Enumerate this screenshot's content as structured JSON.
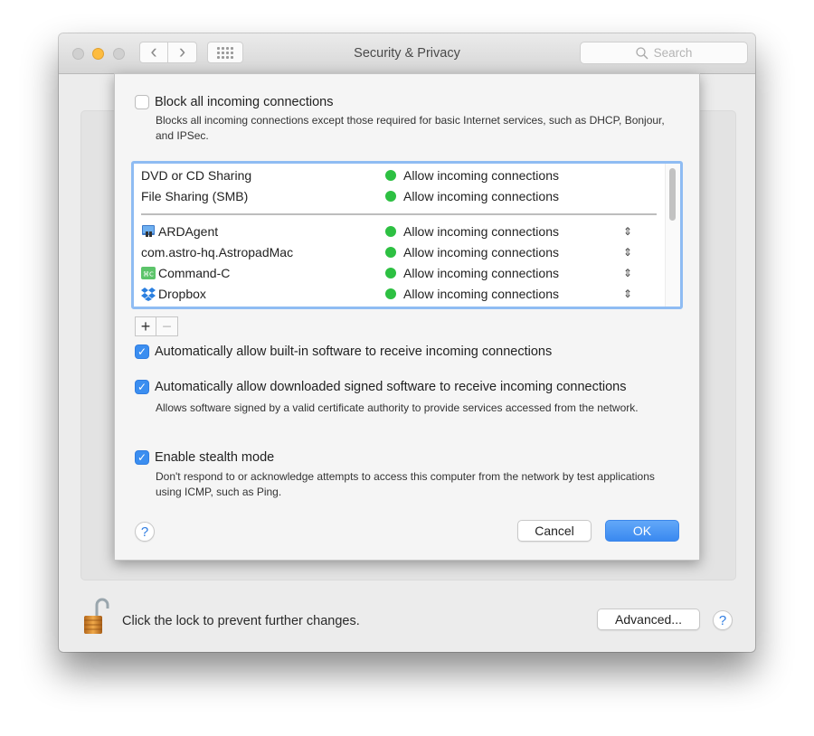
{
  "window": {
    "title": "Security & Privacy",
    "search_placeholder": "Search",
    "nav": {
      "back_icon": "‹",
      "forward_icon": "›"
    }
  },
  "sheet": {
    "block_all": {
      "label": "Block all incoming connections",
      "checked": false,
      "description": "Blocks all incoming connections except those required for basic Internet services,  such as DHCP, Bonjour, and IPSec."
    },
    "services": [
      {
        "name": "DVD or CD Sharing",
        "status": "Allow incoming connections"
      },
      {
        "name": "File Sharing (SMB)",
        "status": "Allow incoming connections"
      }
    ],
    "apps": [
      {
        "name": "ARDAgent",
        "icon": "ardagent-icon",
        "status": "Allow incoming connections"
      },
      {
        "name": "com.astro-hq.AstropadMac",
        "icon": "",
        "status": "Allow incoming connections"
      },
      {
        "name": "Command-C",
        "icon": "command-c-icon",
        "status": "Allow incoming connections"
      },
      {
        "name": "Dropbox",
        "icon": "dropbox-icon",
        "status": "Allow incoming connections"
      }
    ],
    "add_label": "+",
    "remove_label": "−",
    "auto_builtin": {
      "label": "Automatically allow built-in software to receive incoming connections",
      "checked": true
    },
    "auto_signed": {
      "label": "Automatically allow downloaded signed software to receive incoming connections",
      "checked": true,
      "description": "Allows software signed by a valid certificate authority to provide services accessed from the network."
    },
    "stealth": {
      "label": "Enable stealth mode",
      "checked": true,
      "description": "Don't respond to or acknowledge attempts to access this computer from the network by test applications using ICMP, such as Ping."
    },
    "help_label": "?",
    "cancel_label": "Cancel",
    "ok_label": "OK"
  },
  "footer": {
    "lock_text": "Click the lock to prevent further changes.",
    "advanced_label": "Advanced...",
    "help_label": "?"
  },
  "colors": {
    "accent": "#3b8ef0",
    "status_green": "#2dc042",
    "minimize_yellow": "#fdbc40"
  }
}
